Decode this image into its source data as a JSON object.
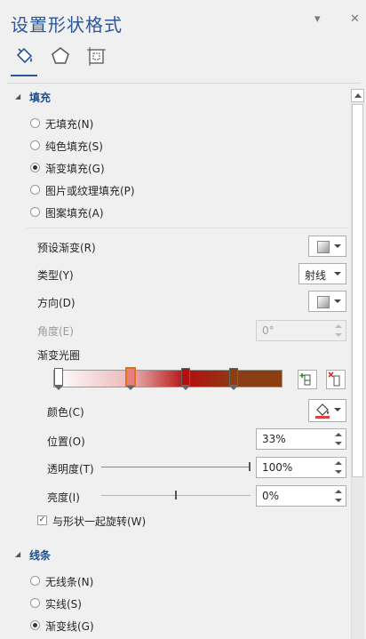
{
  "panel": {
    "title": "设置形状格式",
    "pin_glyph": "▾",
    "close_glyph": "✕"
  },
  "tabs": [
    {
      "icon": "paint-bucket-icon"
    },
    {
      "icon": "pentagon-icon"
    },
    {
      "icon": "layout-properties-icon"
    }
  ],
  "fill": {
    "header": "填充",
    "options": [
      {
        "label": "无填充(N)",
        "selected": false
      },
      {
        "label": "纯色填充(S)",
        "selected": false
      },
      {
        "label": "渐变填充(G)",
        "selected": true
      },
      {
        "label": "图片或纹理填充(P)",
        "selected": false
      },
      {
        "label": "图案填充(A)",
        "selected": false
      }
    ],
    "preset_label": "预设渐变(R)",
    "type_label": "类型(Y)",
    "type_value": "射线",
    "direction_label": "方向(D)",
    "angle_label": "角度(E)",
    "angle_value": "0°",
    "stops_label": "渐变光圈",
    "gradient_stops": [
      {
        "position": 0,
        "color": "#ffffff"
      },
      {
        "position": 0.33,
        "color": "#e57f7f"
      },
      {
        "position": 0.58,
        "color": "#b30f0f"
      },
      {
        "position": 0.8,
        "color": "#8b3f10"
      }
    ],
    "selected_stop": 1,
    "color_label": "颜色(C)",
    "position_label": "位置(O)",
    "position_value": "33%",
    "transparency_label": "透明度(T)",
    "transparency_value": "100%",
    "transparency_level": 1.0,
    "brightness_label": "亮度(I)",
    "brightness_value": "0%",
    "brightness_level": 0.5,
    "rotate_label": "与形状一起旋转(W)",
    "rotate_checked": true
  },
  "line": {
    "header": "线条",
    "options": [
      {
        "label": "无线条(N)",
        "selected": false
      },
      {
        "label": "实线(S)",
        "selected": false
      },
      {
        "label": "渐变线(G)",
        "selected": true
      }
    ]
  },
  "colors": {
    "accent": "#2b579a",
    "paint_bar": "#e04040"
  }
}
